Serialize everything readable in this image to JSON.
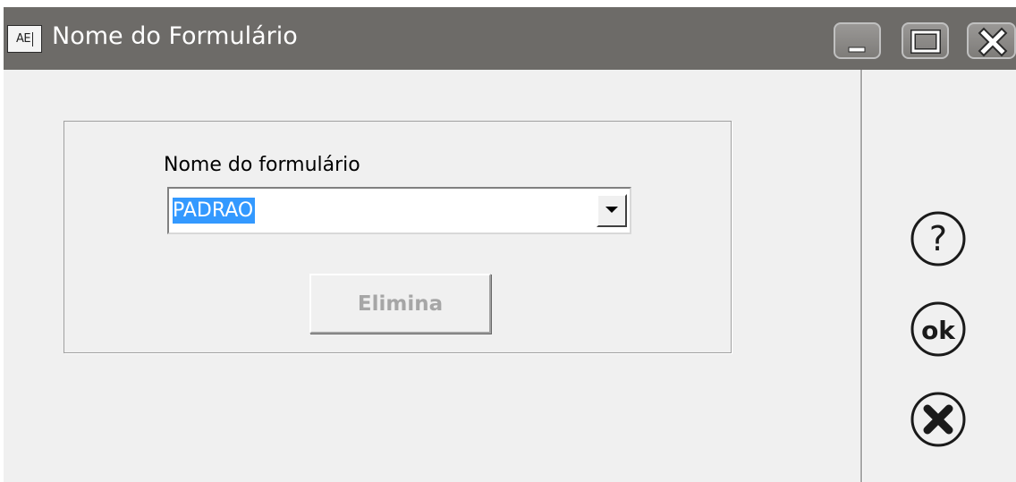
{
  "window": {
    "app_icon_text": "AE",
    "title": "Nome do Formulário",
    "controls": [
      "minimize-icon",
      "maximize-icon",
      "close-icon"
    ]
  },
  "form": {
    "field_label": "Nome do formulário",
    "combo_value": "PADRAO",
    "combo_button_icon": "dropdown-arrow-icon",
    "delete_button_label": "Elimina",
    "delete_button_enabled": false
  },
  "side_buttons": {
    "help_icon": "question-circle-icon",
    "ok_icon": "ok-circle-icon",
    "ok_text": "ok",
    "cancel_icon": "x-circle-icon"
  },
  "colors": {
    "titlebar": "#6d6b68",
    "selection": "#3399ff",
    "disabled_text": "#a6a6a6"
  }
}
